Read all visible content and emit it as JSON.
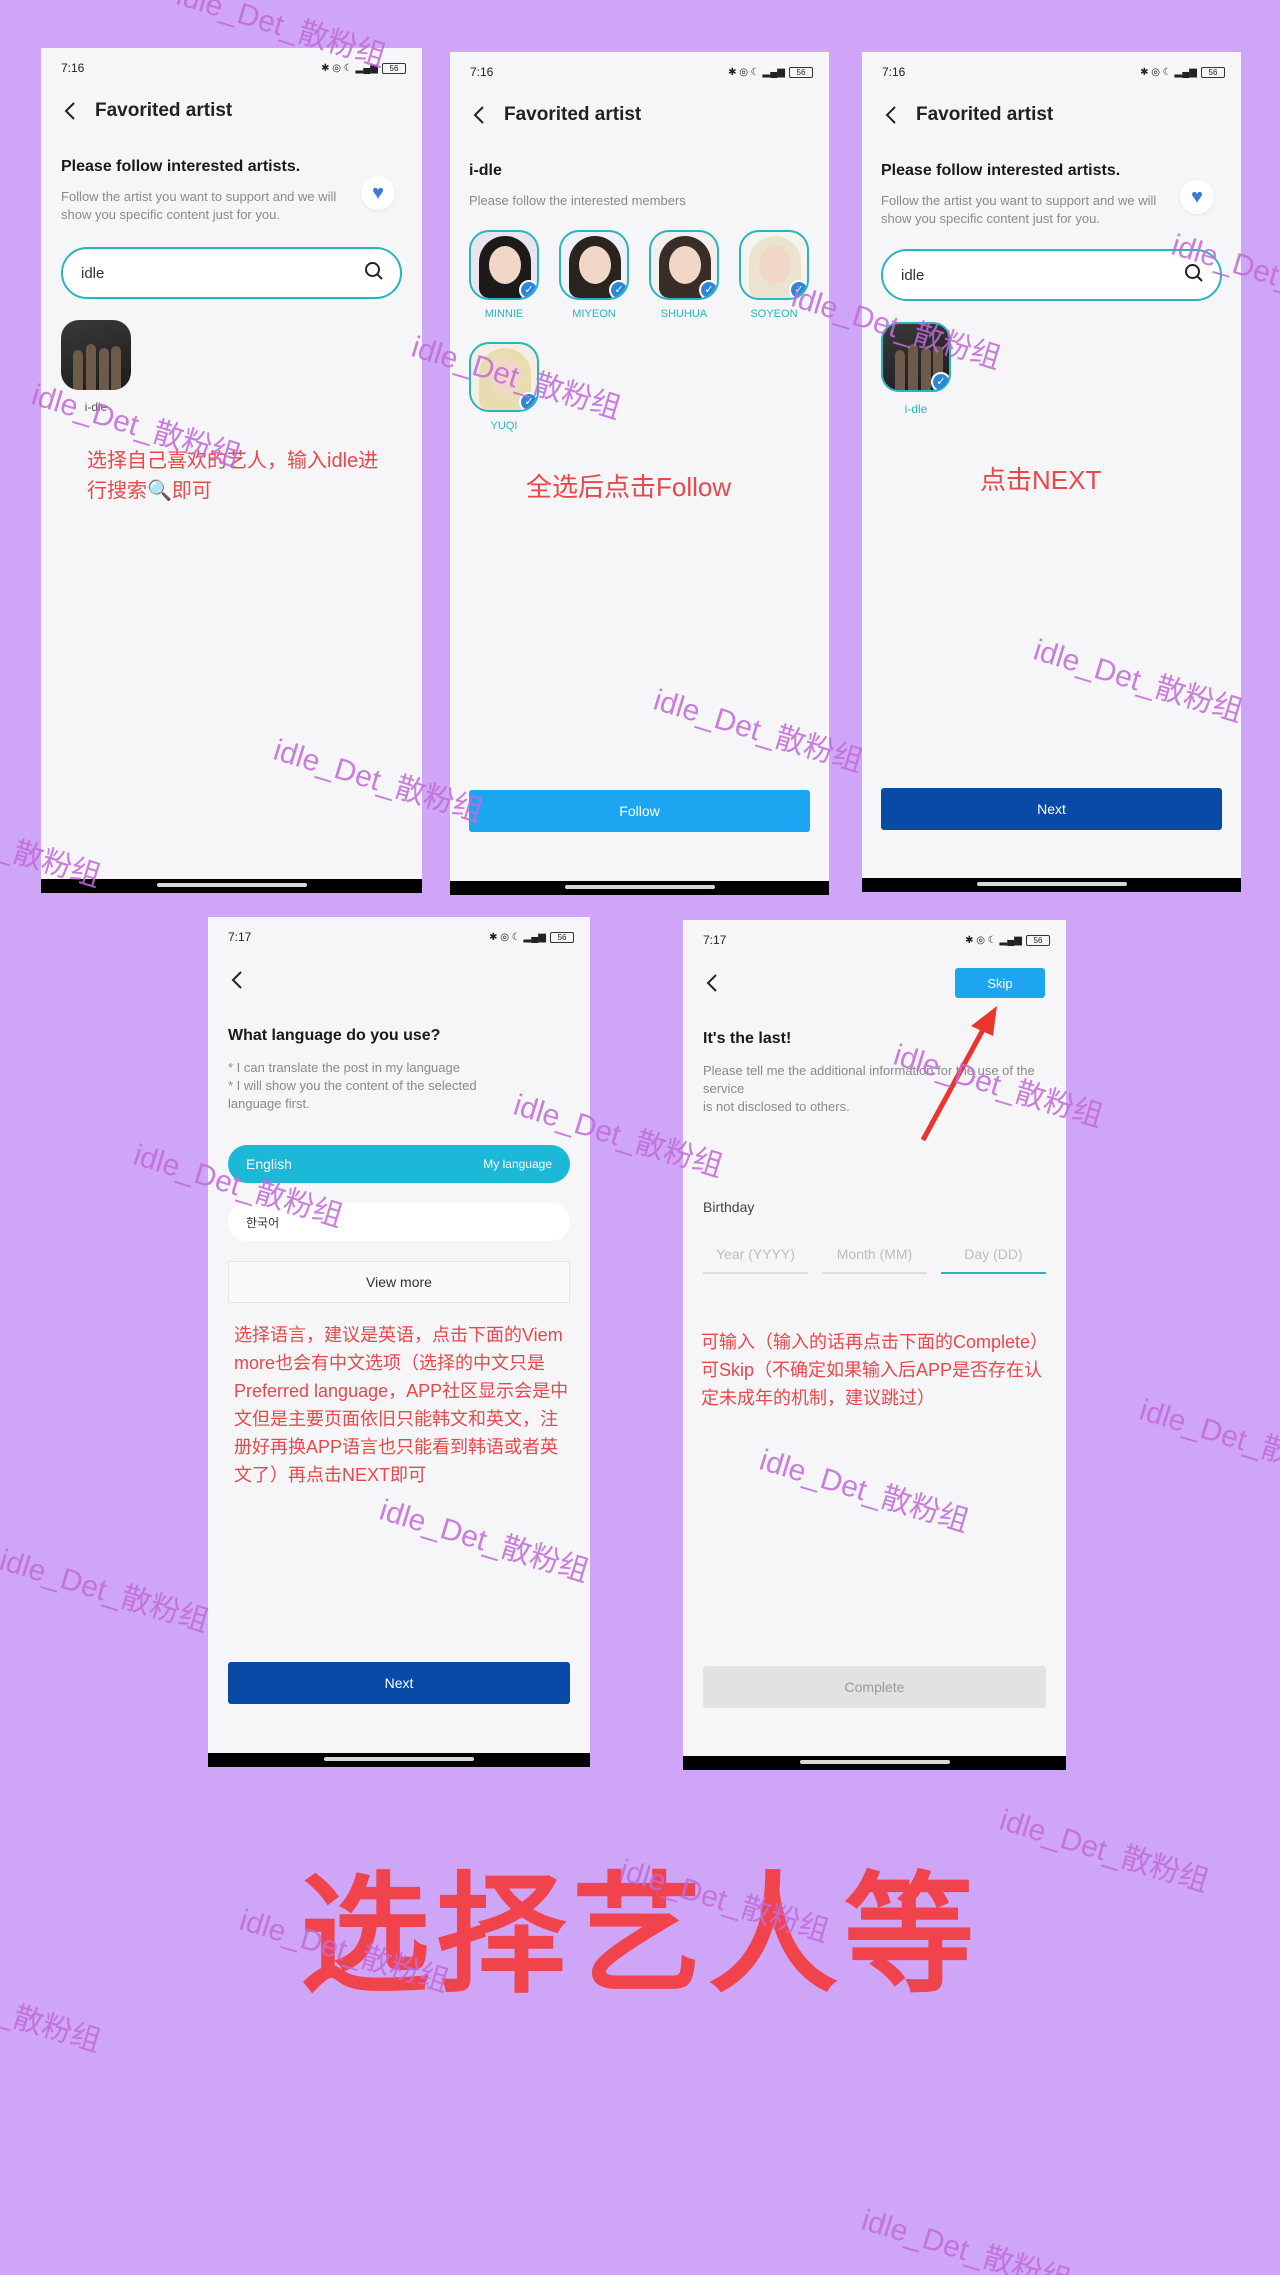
{
  "watermark_text": "idle_Det_散粉组",
  "big_title": "选择艺人等",
  "screen1": {
    "time": "7:16",
    "battery": "56",
    "nav_title": "Favorited artist",
    "heading": "Please follow interested artists.",
    "subtext": "Follow the artist you want to support and we will show you specific content just for you.",
    "search_value": "idle",
    "result_label": "i-dle",
    "note": "选择自己喜欢的艺人，输入idle进行搜索🔍即可"
  },
  "screen2": {
    "time": "7:16",
    "battery": "56",
    "nav_title": "Favorited artist",
    "group_name": "i-dle",
    "subtext": "Please follow the interested members",
    "members": [
      "MINNIE",
      "MIYEON",
      "SHUHUA",
      "SOYEON",
      "YUQI"
    ],
    "note": "全选后点击Follow",
    "follow_label": "Follow"
  },
  "screen3": {
    "time": "7:16",
    "battery": "56",
    "nav_title": "Favorited artist",
    "heading": "Please follow interested artists.",
    "subtext": "Follow the artist you want to support and we will show you specific content just for you.",
    "search_value": "idle",
    "result_label": "i-dle",
    "note": "点击NEXT",
    "next_label": "Next"
  },
  "screen4": {
    "time": "7:17",
    "battery": "56",
    "heading": "What language do you use?",
    "bullet1": "* I can translate the post in my language",
    "bullet2": "* I will show you the content of the selected language first.",
    "selected_language": "English",
    "my_language_tag": "My language",
    "other_language": "한국어",
    "view_more_label": "View more",
    "note": "选择语言，建议是英语，点击下面的Viem more也会有中文选项（选择的中文只是Preferred language，APP社区显示会是中文但是主要页面依旧只能韩文和英文，注册好再换APP语言也只能看到韩语或者英文了）再点击NEXT即可",
    "next_label": "Next"
  },
  "screen5": {
    "time": "7:17",
    "battery": "56",
    "skip_label": "Skip",
    "heading": "It's the last!",
    "subtext": "Please tell me the additional information for the use of the service\nis not disclosed to others.",
    "birthday_label": "Birthday",
    "year_placeholder": "Year (YYYY)",
    "month_placeholder": "Month (MM)",
    "day_placeholder": "Day (DD)",
    "note": "可输入（输入的话再点击下面的Complete）可Skip（不确定如果输入后APP是否存在认定未成年的机制，建议跳过）",
    "complete_label": "Complete"
  },
  "colors": {
    "background": "#cfa5f8",
    "accent_teal": "#2bb3c0",
    "follow_blue": "#1ea5f2",
    "next_navy": "#0a4aa7",
    "note_red": "#e8484b"
  }
}
